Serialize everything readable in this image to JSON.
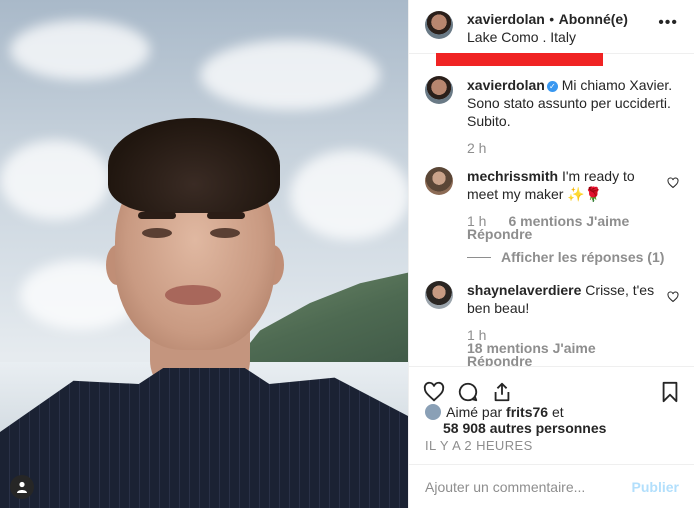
{
  "header": {
    "username": "xavierdolan",
    "separator": "•",
    "follow_label": "Abonné(e)",
    "location": "Lake Como . Italy",
    "more_label": "•••"
  },
  "caption": {
    "username": "xavierdolan",
    "verified_mark": "✓",
    "text": "Mi chiamo Xavier. Sono stato assunto per ucciderti. Subito.",
    "time": "2 h"
  },
  "comments": [
    {
      "username": "mechrissmith",
      "text": "I'm ready to meet my maker ✨🌹",
      "time": "1 h",
      "likes": "6 mentions J'aime",
      "reply": "Répondre",
      "view_replies": "Afficher les réponses (1)"
    },
    {
      "username": "shaynelaverdiere",
      "text": "Crisse, t'es ben beau!",
      "time": "1 h",
      "likes": "18 mentions J'aime",
      "reply": "Répondre"
    }
  ],
  "likes_line": {
    "prefix": "Aimé par",
    "user": "frits76",
    "conj": "et",
    "others": "58 908 autres personnes"
  },
  "time_ago": "IL Y A 2 HEURES",
  "comment_box": {
    "placeholder": "Ajouter un commentaire...",
    "publish_label": "Publier"
  },
  "colors": {
    "accent": "#3897f0",
    "redaction": "#f02323",
    "publish_disabled": "#b2dffc"
  }
}
